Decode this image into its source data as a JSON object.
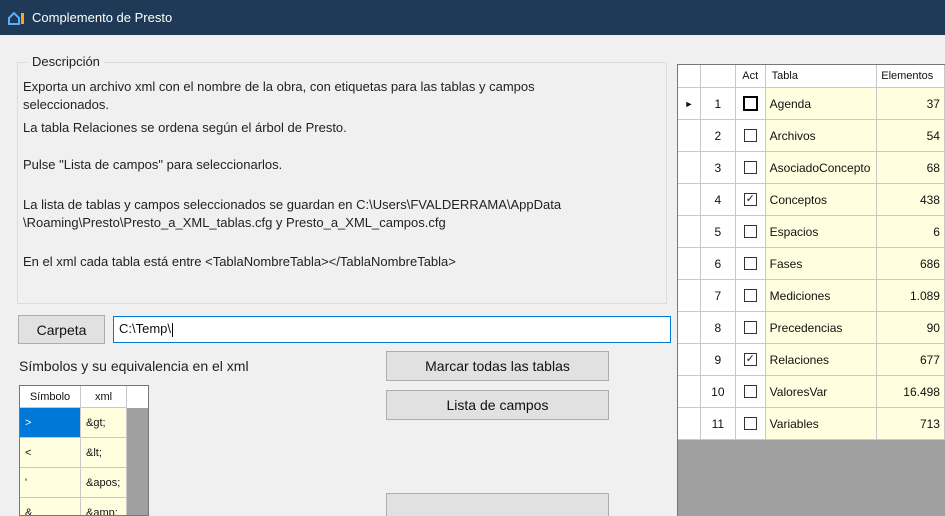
{
  "window": {
    "title": "Complemento de Presto"
  },
  "description": {
    "legend": "Descripción",
    "lines": [
      "Exporta un archivo xml con el nombre de la obra, con etiquetas para las tablas y campos",
      "seleccionados.",
      "La tabla Relaciones se ordena según el árbol de Presto.",
      "Pulse \"Lista de campos\" para seleccionarlos.",
      "La lista de tablas y campos seleccionados se guardan en C:\\Users\\FVALDERRAMA\\AppData",
      "\\Roaming\\Presto\\Presto_a_XML_tablas.cfg y Presto_a_XML_campos.cfg",
      "En el xml cada tabla está entre <TablaNombreTabla></TablaNombreTabla>"
    ]
  },
  "folder": {
    "button_label": "Carpeta",
    "value": "C:\\Temp\\"
  },
  "symbols": {
    "label": "Símbolos y su equivalencia en el xml",
    "columns": [
      "Símbolo",
      "xml"
    ],
    "rows": [
      {
        "symbol": ">",
        "xml": "&gt;"
      },
      {
        "symbol": "<",
        "xml": "&lt;"
      },
      {
        "symbol": "'",
        "xml": "&apos;"
      },
      {
        "symbol": "&",
        "xml": "&amp;"
      }
    ]
  },
  "buttons": {
    "mark_all": "Marcar todas las tablas",
    "field_list": "Lista de campos"
  },
  "tables_grid": {
    "columns": [
      "",
      "",
      "Act",
      "Tabla",
      "Elementos"
    ],
    "current_row_indicator": "►",
    "rows": [
      {
        "num": "1",
        "active": false,
        "name": "Agenda",
        "count": "37"
      },
      {
        "num": "2",
        "active": false,
        "name": "Archivos",
        "count": "54"
      },
      {
        "num": "3",
        "active": false,
        "name": "AsociadoConcepto",
        "count": "68"
      },
      {
        "num": "4",
        "active": true,
        "name": "Conceptos",
        "count": "438"
      },
      {
        "num": "5",
        "active": false,
        "name": "Espacios",
        "count": "6"
      },
      {
        "num": "6",
        "active": false,
        "name": "Fases",
        "count": "686"
      },
      {
        "num": "7",
        "active": false,
        "name": "Mediciones",
        "count": "1.089"
      },
      {
        "num": "8",
        "active": false,
        "name": "Precedencias",
        "count": "90"
      },
      {
        "num": "9",
        "active": true,
        "name": "Relaciones",
        "count": "677"
      },
      {
        "num": "10",
        "active": false,
        "name": "ValoresVar",
        "count": "16.498"
      },
      {
        "num": "11",
        "active": false,
        "name": "Variables",
        "count": "713"
      }
    ]
  },
  "colors": {
    "titlebar": "#1f3a56",
    "cell_highlight": "#ffffe0",
    "selection": "#0078d7",
    "grid_background": "#a0a0a0"
  }
}
